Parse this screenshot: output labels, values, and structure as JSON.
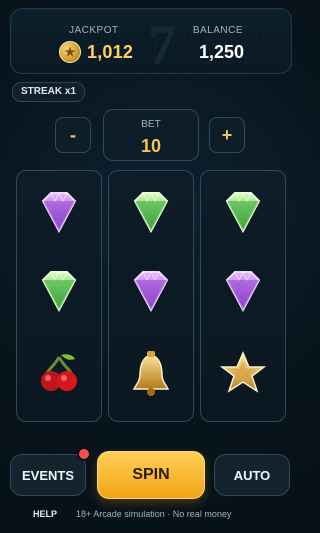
{
  "header": {
    "jackpot_label": "JACKPOT",
    "jackpot_value": "1,012",
    "balance_label": "BALANCE",
    "balance_value": "1,250",
    "seven_glyph": "7"
  },
  "streak": {
    "label": "STREAK x1"
  },
  "bet": {
    "minus_label": "-",
    "plus_label": "+",
    "label": "BET",
    "value": "10"
  },
  "reels": [
    [
      "purple-diamond",
      "green-diamond",
      "cherry"
    ],
    [
      "green-diamond",
      "purple-diamond",
      "bell"
    ],
    [
      "green-diamond",
      "purple-diamond",
      "star"
    ]
  ],
  "controls": {
    "events_label": "EVENTS",
    "spin_label": "SPIN",
    "auto_label": "AUTO",
    "events_notification": true
  },
  "footer": {
    "help_label": "HELP",
    "disclaimer": "18+ Arcade simulation · No real money"
  },
  "colors": {
    "accent_gold": "#f2b52b",
    "jackpot_text": "#ffd15c",
    "notification": "#ff4d4d"
  },
  "icons": {
    "coin": "coin-icon",
    "purple_diamond": "purple-diamond-icon",
    "green_diamond": "green-diamond-icon",
    "cherry": "cherry-icon",
    "bell": "bell-icon",
    "star": "star-icon"
  }
}
